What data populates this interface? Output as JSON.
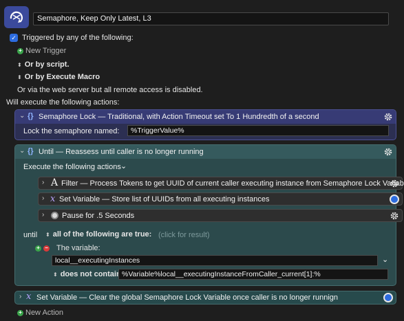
{
  "header": {
    "macro_name": "Semaphore, Keep Only Latest, L3"
  },
  "triggers": {
    "triggered_label": "Triggered by any of the following:",
    "new_trigger": "New Trigger",
    "or_by_script": "Or by script.",
    "or_by_execute_macro": "Or by Execute Macro",
    "web_server_note": "Or via the web server but all remote access is disabled."
  },
  "actions_label": "Will execute the following actions:",
  "semaphore_lock": {
    "title": "Semaphore Lock — Traditional, with Action Timeout set To 1 Hundredth of a second",
    "field_label": "Lock the semaphore named:",
    "field_value": "%TriggerValue%"
  },
  "until": {
    "title": "Until — Reassess until caller is no longer running",
    "execute_label": "Execute the following actions",
    "sub_actions": [
      {
        "label": "Filter — Process Tokens to get UUID of current caller executing instance from Semaphore Lock Variable"
      },
      {
        "label": "Set Variable — Store list of UUIDs from all executing instances"
      },
      {
        "label": "Pause for .5 Seconds"
      }
    ],
    "until_label": "until",
    "condition_mode": "all of the following are true:",
    "click_for_result": "(click for result)",
    "variable_label": "The variable:",
    "variable_name": "local__executingInstances",
    "operator": "does not contain",
    "operand": "%Variable%local__executingInstanceFromCaller_current[1]:%"
  },
  "set_variable_final": {
    "title": "Set Variable — Clear the global Semaphore Lock Variable once caller is no longer runnign"
  },
  "new_action": "New Action",
  "colors": {
    "background": "#1e1e1e",
    "lock_block": "#373b75",
    "until_block": "#355a5d",
    "accent_blue": "#2d6cdf",
    "add_green": "#3aa34a",
    "remove_red": "#d93a3a"
  }
}
